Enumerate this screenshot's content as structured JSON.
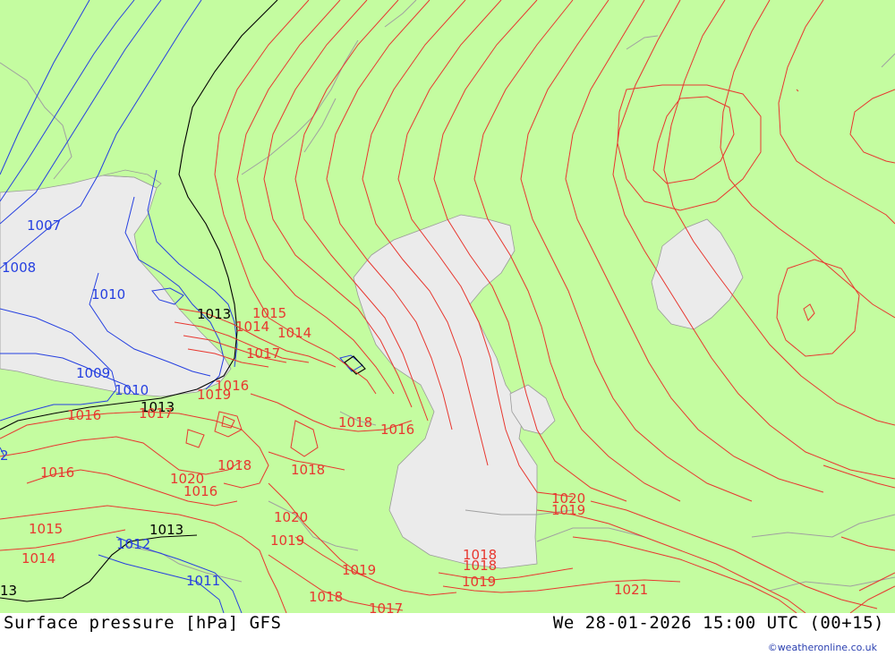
{
  "footer": {
    "title": "Surface pressure [hPa] GFS",
    "time": "We 28-01-2026 15:00 UTC (00+15)",
    "credit": "©weatheronline.co.uk"
  },
  "colors": {
    "land": "#c4fca0",
    "water": "#ebebeb",
    "high_isobar": "#e8372f",
    "low_isobar": "#2640e0",
    "ref_isobar": "#000000",
    "border": "#a0a0a0"
  },
  "isobar_labels": [
    {
      "text": "1007",
      "color": "low"
    },
    {
      "text": "1008",
      "color": "low"
    },
    {
      "text": "1010",
      "color": "low"
    },
    {
      "text": "1009",
      "color": "low"
    },
    {
      "text": "1010",
      "color": "low"
    },
    {
      "text": "1012",
      "color": "low"
    },
    {
      "text": "1011",
      "color": "low"
    },
    {
      "text": "1013",
      "color": "ref"
    },
    {
      "text": "1013",
      "color": "ref"
    },
    {
      "text": "1013",
      "color": "ref"
    },
    {
      "text": "13",
      "color": "ref"
    },
    {
      "text": "1015",
      "color": "high"
    },
    {
      "text": "1014",
      "color": "high"
    },
    {
      "text": "1014",
      "color": "high"
    },
    {
      "text": "1017",
      "color": "high"
    },
    {
      "text": "1016",
      "color": "high"
    },
    {
      "text": "1019",
      "color": "high"
    },
    {
      "text": "1016",
      "color": "high"
    },
    {
      "text": "1017",
      "color": "high"
    },
    {
      "text": "1016",
      "color": "high"
    },
    {
      "text": "1018",
      "color": "high"
    },
    {
      "text": "1018",
      "color": "high"
    },
    {
      "text": "1016",
      "color": "high"
    },
    {
      "text": "1018",
      "color": "high"
    },
    {
      "text": "1020",
      "color": "high"
    },
    {
      "text": "1016",
      "color": "high"
    },
    {
      "text": "1015",
      "color": "high"
    },
    {
      "text": "1014",
      "color": "high"
    },
    {
      "text": "1020",
      "color": "high"
    },
    {
      "text": "1019",
      "color": "high"
    },
    {
      "text": "1019",
      "color": "high"
    },
    {
      "text": "1018",
      "color": "high"
    },
    {
      "text": "1017",
      "color": "high"
    },
    {
      "text": "1018",
      "color": "high"
    },
    {
      "text": "1018",
      "color": "high"
    },
    {
      "text": "1019",
      "color": "high"
    },
    {
      "text": "1020",
      "color": "high"
    },
    {
      "text": "1019",
      "color": "high"
    },
    {
      "text": "1021",
      "color": "high"
    },
    {
      "text": "2",
      "color": "low"
    }
  ]
}
